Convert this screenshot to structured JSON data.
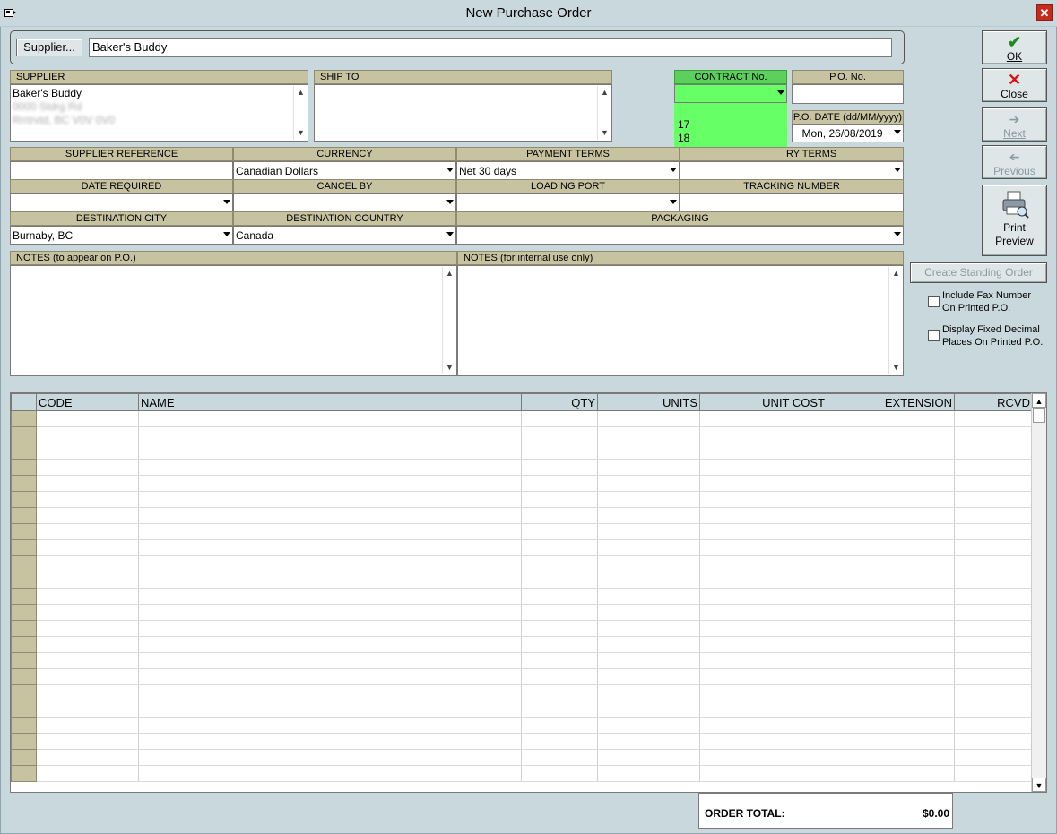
{
  "window": {
    "title": "New Purchase Order",
    "close_glyph": "✕"
  },
  "supplier": {
    "button_label": "Supplier...",
    "name": "Baker's Buddy"
  },
  "headers": {
    "supplier": "SUPPLIER",
    "ship_to": "SHIP TO",
    "contract_no": "CONTRACT No.",
    "po_no": "P.O. No.",
    "po_date": "P.O. DATE (dd/MM/yyyy)",
    "supplier_reference": "SUPPLIER REFERENCE",
    "currency": "CURRENCY",
    "payment_terms": "PAYMENT TERMS",
    "delivery_terms": "RY TERMS",
    "date_required": "DATE REQUIRED",
    "cancel_by": "CANCEL BY",
    "loading_port": "LOADING PORT",
    "tracking_number": "TRACKING NUMBER",
    "destination_city": "DESTINATION CITY",
    "destination_country": "DESTINATION COUNTRY",
    "packaging": "PACKAGING",
    "notes_po": "NOTES (to appear on P.O.)",
    "notes_internal": "NOTES (for internal use only)"
  },
  "supplier_address": {
    "line1": "Baker's Buddy",
    "line2": "0000 Stdrg Rd",
    "line3": "Rrrtrvtd, BC V0V 0V0"
  },
  "values": {
    "po_date": "Mon, 26/08/2019",
    "currency": "Canadian Dollars",
    "payment_terms": "Net 30 days",
    "destination_city": "Burnaby, BC",
    "destination_country": "Canada"
  },
  "contract_dropdown": {
    "options": [
      "17",
      "18"
    ],
    "color": "#66ff66"
  },
  "side_buttons": {
    "ok": "OK",
    "close": "Close",
    "next": "Next",
    "previous": "Previous",
    "print_preview_1": "Print",
    "print_preview_2": "Preview",
    "create_standing_order": "Create Standing Order"
  },
  "checkboxes": {
    "fax_1": "Include Fax Number",
    "fax_2": "On Printed P.O.",
    "decimal_1": "Display Fixed Decimal",
    "decimal_2": "Places On Printed P.O."
  },
  "grid": {
    "columns": [
      "CODE",
      "NAME",
      "QTY",
      "UNITS",
      "UNIT COST",
      "EXTENSION",
      "RCVD"
    ],
    "rows": 23
  },
  "totals": {
    "label": "ORDER TOTAL:",
    "value": "$0.00"
  }
}
